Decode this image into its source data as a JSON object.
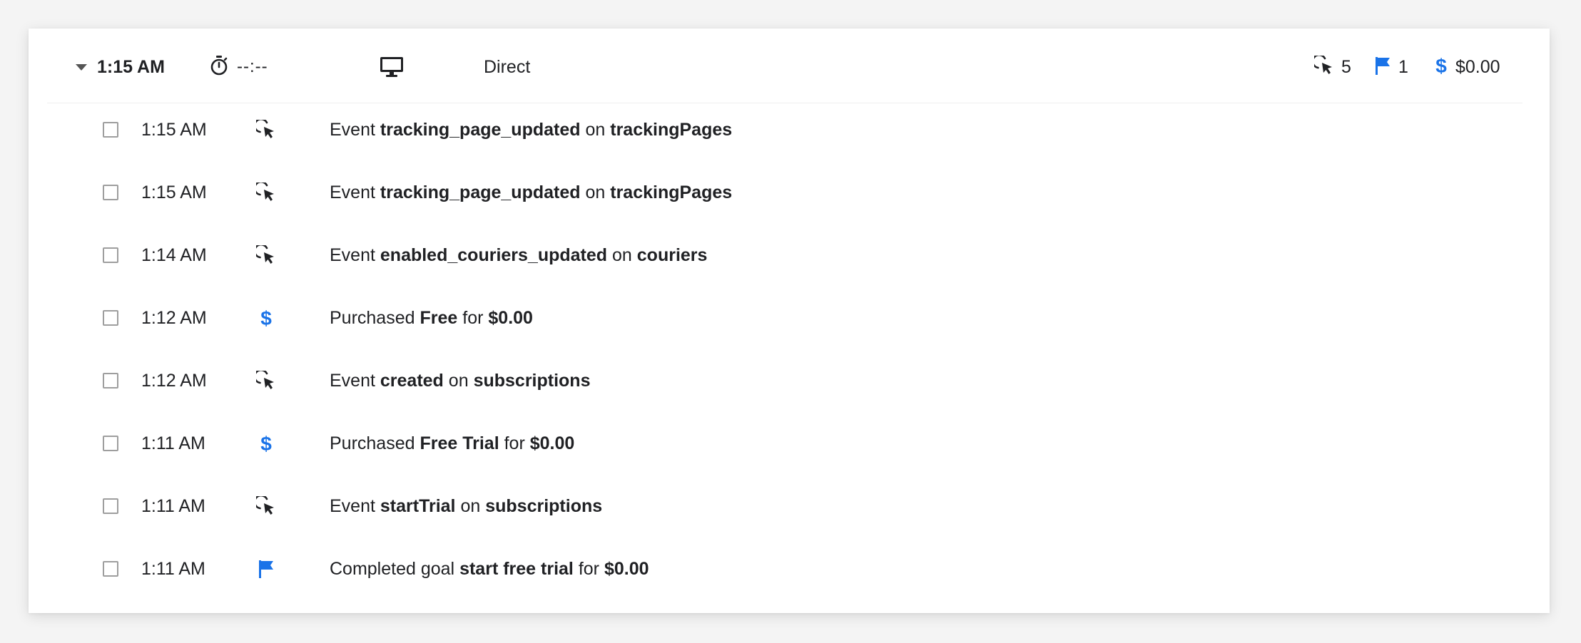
{
  "session": {
    "time": "1:15 AM",
    "duration": "--:--",
    "device_icon": "desktop-icon",
    "source": "Direct",
    "stats": {
      "events_count": "5",
      "goals_count": "1",
      "revenue": "$0.00"
    }
  },
  "colors": {
    "accent_blue": "#1a73e8",
    "text": "#202124"
  },
  "rows": [
    {
      "time": "1:15 AM",
      "icon": "cursor-click-icon",
      "prefix": "Event",
      "bold1": "tracking_page_updated",
      "mid": "on",
      "bold2": "trackingPages"
    },
    {
      "time": "1:15 AM",
      "icon": "cursor-click-icon",
      "prefix": "Event",
      "bold1": "tracking_page_updated",
      "mid": "on",
      "bold2": "trackingPages"
    },
    {
      "time": "1:14 AM",
      "icon": "cursor-click-icon",
      "prefix": "Event",
      "bold1": "enabled_couriers_updated",
      "mid": "on",
      "bold2": "couriers"
    },
    {
      "time": "1:12 AM",
      "icon": "dollar-icon",
      "prefix": "Purchased",
      "bold1": "Free",
      "mid": "for",
      "bold2": "$0.00"
    },
    {
      "time": "1:12 AM",
      "icon": "cursor-click-icon",
      "prefix": "Event",
      "bold1": "created",
      "mid": "on",
      "bold2": "subscriptions"
    },
    {
      "time": "1:11 AM",
      "icon": "dollar-icon",
      "prefix": "Purchased",
      "bold1": "Free Trial",
      "mid": "for",
      "bold2": "$0.00"
    },
    {
      "time": "1:11 AM",
      "icon": "cursor-click-icon",
      "prefix": "Event",
      "bold1": "startTrial",
      "mid": "on",
      "bold2": "subscriptions"
    },
    {
      "time": "1:11 AM",
      "icon": "flag-icon",
      "prefix": "Completed goal",
      "bold1": "start free trial",
      "mid": "for",
      "bold2": "$0.00"
    }
  ]
}
